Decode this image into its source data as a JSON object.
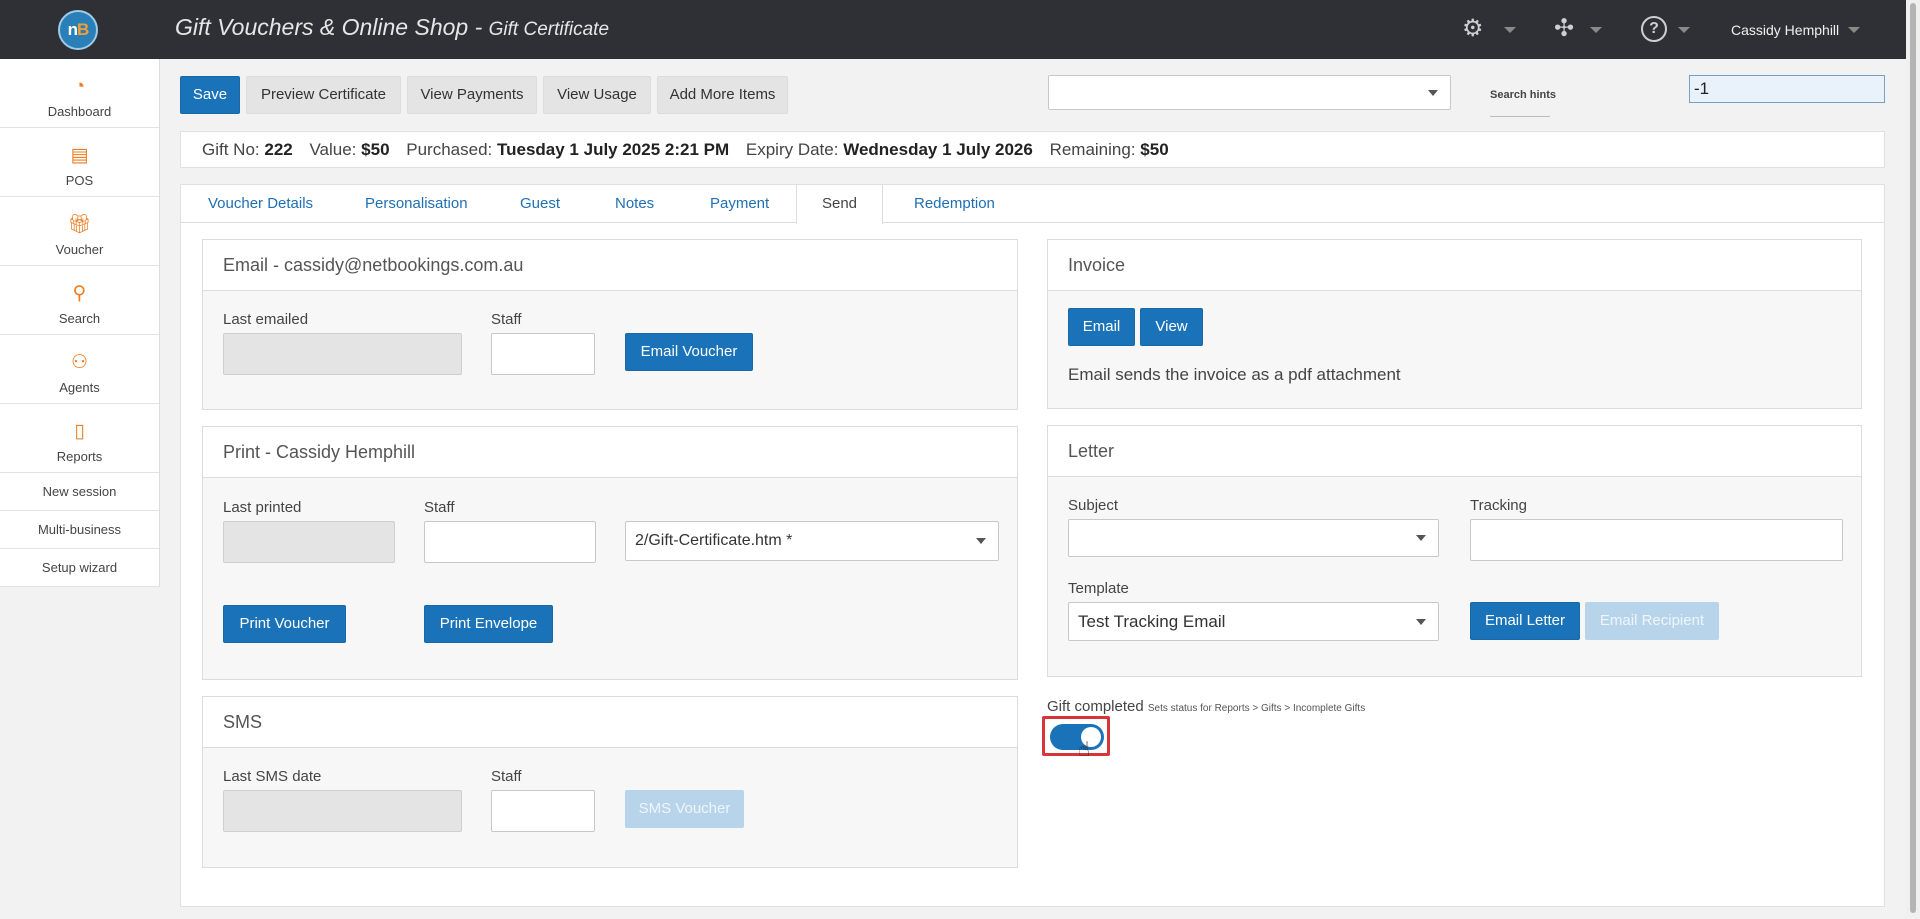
{
  "header": {
    "logo_text_n": "n",
    "logo_text_b": "B",
    "title": "Gift Vouchers & Online Shop - ",
    "subtitle": "Gift Certificate",
    "user_name": "Cassidy Hemphill",
    "icons": [
      "gears-icon",
      "puzzle-icon",
      "help-icon"
    ]
  },
  "sidebar": {
    "items": [
      {
        "label": "Dashboard",
        "icon": "speedometer-icon"
      },
      {
        "label": "POS",
        "icon": "register-icon"
      },
      {
        "label": "Voucher",
        "icon": "gift-icon"
      },
      {
        "label": "Search",
        "icon": "search-icon"
      },
      {
        "label": "Agents",
        "icon": "agents-icon"
      },
      {
        "label": "Reports",
        "icon": "report-icon"
      }
    ],
    "links": [
      "New session",
      "Multi-business",
      "Setup wizard"
    ]
  },
  "toolbar": {
    "save": "Save",
    "preview": "Preview Certificate",
    "view_payments": "View Payments",
    "view_usage": "View Usage",
    "add_items": "Add More Items",
    "search_select_value": "",
    "search_hints": "Search hints",
    "id_value": "-1"
  },
  "info": {
    "gift_no_label": "Gift No:",
    "gift_no": "222",
    "value_label": "Value:",
    "value": "$50",
    "purchased_label": "Purchased:",
    "purchased": "Tuesday 1 July 2025 2:21 PM",
    "expiry_label": "Expiry Date:",
    "expiry": "Wednesday 1 July 2026",
    "remaining_label": "Remaining:",
    "remaining": "$50"
  },
  "tabs": [
    "Voucher Details",
    "Personalisation",
    "Guest",
    "Notes",
    "Payment",
    "Send",
    "Redemption"
  ],
  "active_tab": "Send",
  "email_panel": {
    "title": "Email - cassidy@netbookings.com.au",
    "last_emailed_label": "Last emailed",
    "last_emailed": "",
    "staff_label": "Staff",
    "staff": "",
    "button": "Email Voucher"
  },
  "print_panel": {
    "title": "Print - Cassidy Hemphill",
    "last_printed_label": "Last printed",
    "last_printed": "",
    "staff_label": "Staff",
    "staff": "",
    "template_select": "2/Gift-Certificate.htm *",
    "print_voucher": "Print Voucher",
    "print_envelope": "Print Envelope"
  },
  "sms_panel": {
    "title": "SMS",
    "last_sms_label": "Last SMS date",
    "last_sms": "",
    "staff_label": "Staff",
    "staff": "",
    "button": "SMS Voucher"
  },
  "invoice_panel": {
    "title": "Invoice",
    "email_button": "Email",
    "view_button": "View",
    "note": "Email sends the invoice as a pdf attachment"
  },
  "letter_panel": {
    "title": "Letter",
    "subject_label": "Subject",
    "subject": "",
    "tracking_label": "Tracking",
    "tracking": "",
    "template_label": "Template",
    "template": "Test Tracking Email",
    "email_letter": "Email Letter",
    "email_recipient": "Email Recipient"
  },
  "gift_completed": {
    "label": "Gift completed",
    "hint": "Sets status for Reports > Gifts > Incomplete Gifts",
    "checked": true
  },
  "colors": {
    "accent": "#1a73b8",
    "topbar": "#2e3035",
    "sidebar_icon": "#ef7d22",
    "highlight": "#d9343a"
  }
}
